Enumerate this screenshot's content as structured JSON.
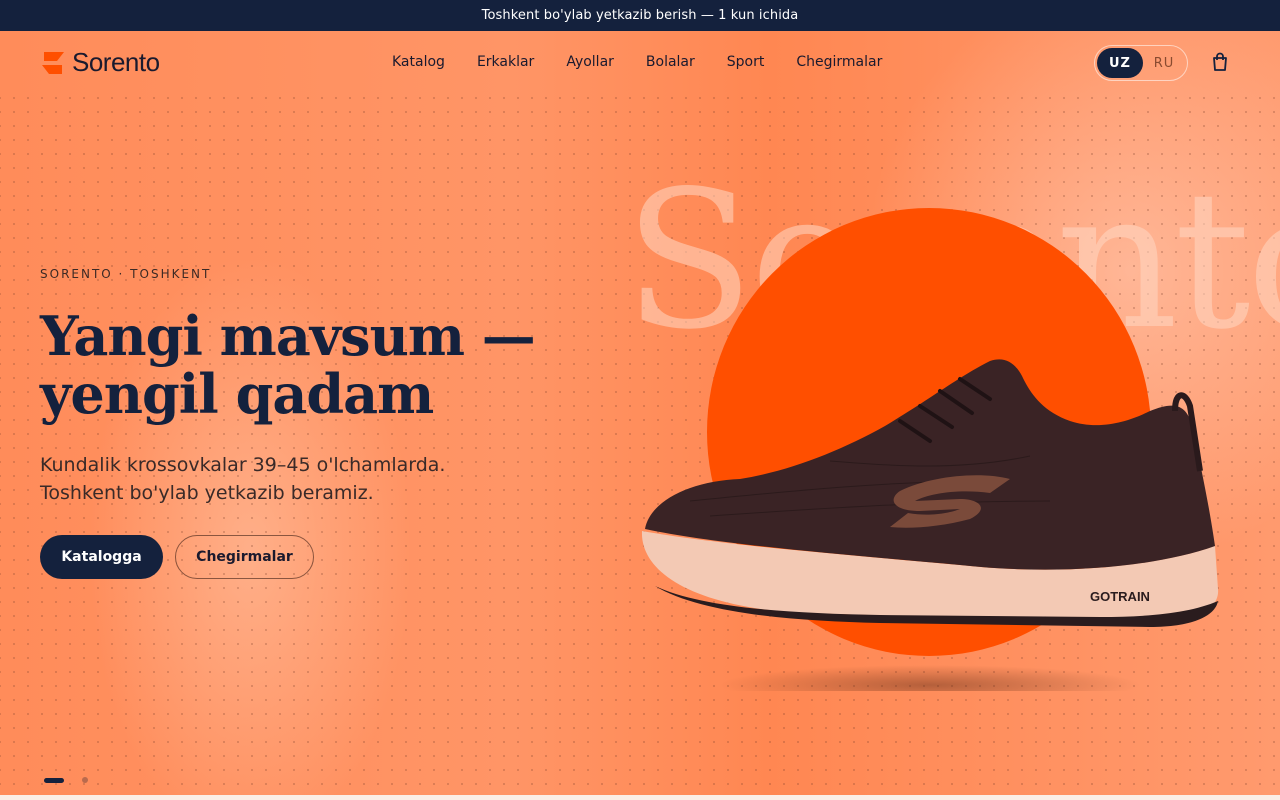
{
  "promo": {
    "text": "Toshkent bo'ylab yetkazib berish — 1 kun ichida"
  },
  "header": {
    "logo_text": "Sorento",
    "nav": [
      "Katalog",
      "Erkaklar",
      "Ayollar",
      "Bolalar",
      "Sport",
      "Chegirmalar"
    ],
    "lang": {
      "active": "UZ",
      "inactive": "RU"
    },
    "cart_icon": "shopping-bag-icon"
  },
  "hero": {
    "eyebrow": "SORENTO · TOSHKENT",
    "headline_line1": "Yangi mavsum —",
    "headline_line2": "yengil qadam",
    "subtext_line1": "Kundalik krossovkalar 39–45 o'lchamlarda.",
    "subtext_line2": "Toshkent bo'ylab yetkazib beramiz.",
    "primary_cta": "Katalogga",
    "secondary_cta": "Chegirmalar",
    "background_word": "Sorento",
    "shoe_brand_text": "GOTRAIN"
  },
  "slider": {
    "count": 2,
    "active_index": 0
  },
  "colors": {
    "navy": "#14213d",
    "accent_orange": "#ff4f00",
    "hero_bg": "#ff8c5a"
  }
}
